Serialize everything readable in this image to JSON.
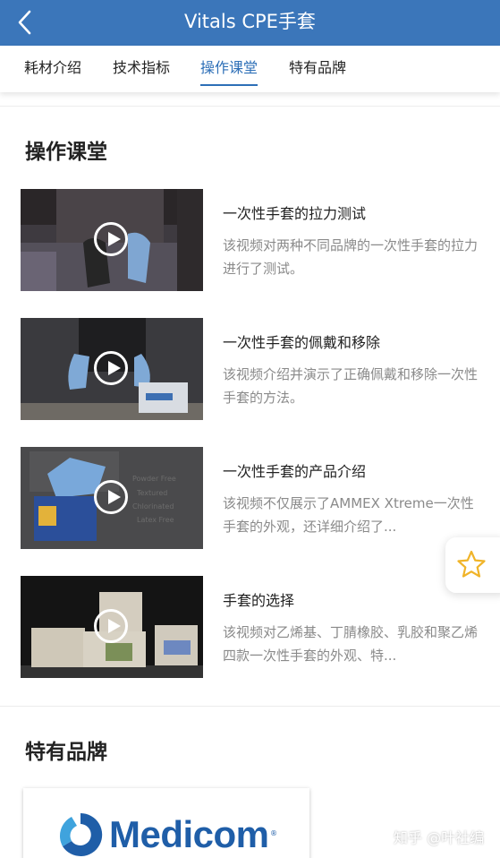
{
  "header": {
    "title": "Vitals CPE手套",
    "background_color": "#3b76ba"
  },
  "tabs": [
    {
      "label": "耗材介绍"
    },
    {
      "label": "技术指标"
    },
    {
      "label": "操作课堂",
      "active": true
    },
    {
      "label": "特有品牌"
    }
  ],
  "lessons": {
    "title": "操作课堂",
    "items": [
      {
        "title": "一次性手套的拉力测试",
        "description": "该视频对两种不同品牌的一次性手套的拉力进行了测试。",
        "icon": "play-icon"
      },
      {
        "title": "一次性手套的佩戴和移除",
        "description": "该视频介绍并演示了正确佩戴和移除一次性手套的方法。",
        "icon": "play-icon"
      },
      {
        "title": "一次性手套的产品介绍",
        "description": "该视频不仅展示了AMMEX Xtreme一次性手套的外观，还详细介绍了...",
        "icon": "play-icon"
      },
      {
        "title": "手套的选择",
        "description": "该视频对乙烯基、丁腈橡胶、乳胶和聚乙烯四款一次性手套的外观、特...",
        "icon": "play-icon"
      }
    ]
  },
  "brands": {
    "title": "特有品牌",
    "items": [
      {
        "name": "Medicom",
        "registered_mark": "®"
      }
    ]
  },
  "favorite": {
    "icon": "star-icon"
  },
  "watermark": "知乎 @叶社编",
  "colors": {
    "accent": "#2d6fb7",
    "brand_logo": "#1f5ea8"
  }
}
